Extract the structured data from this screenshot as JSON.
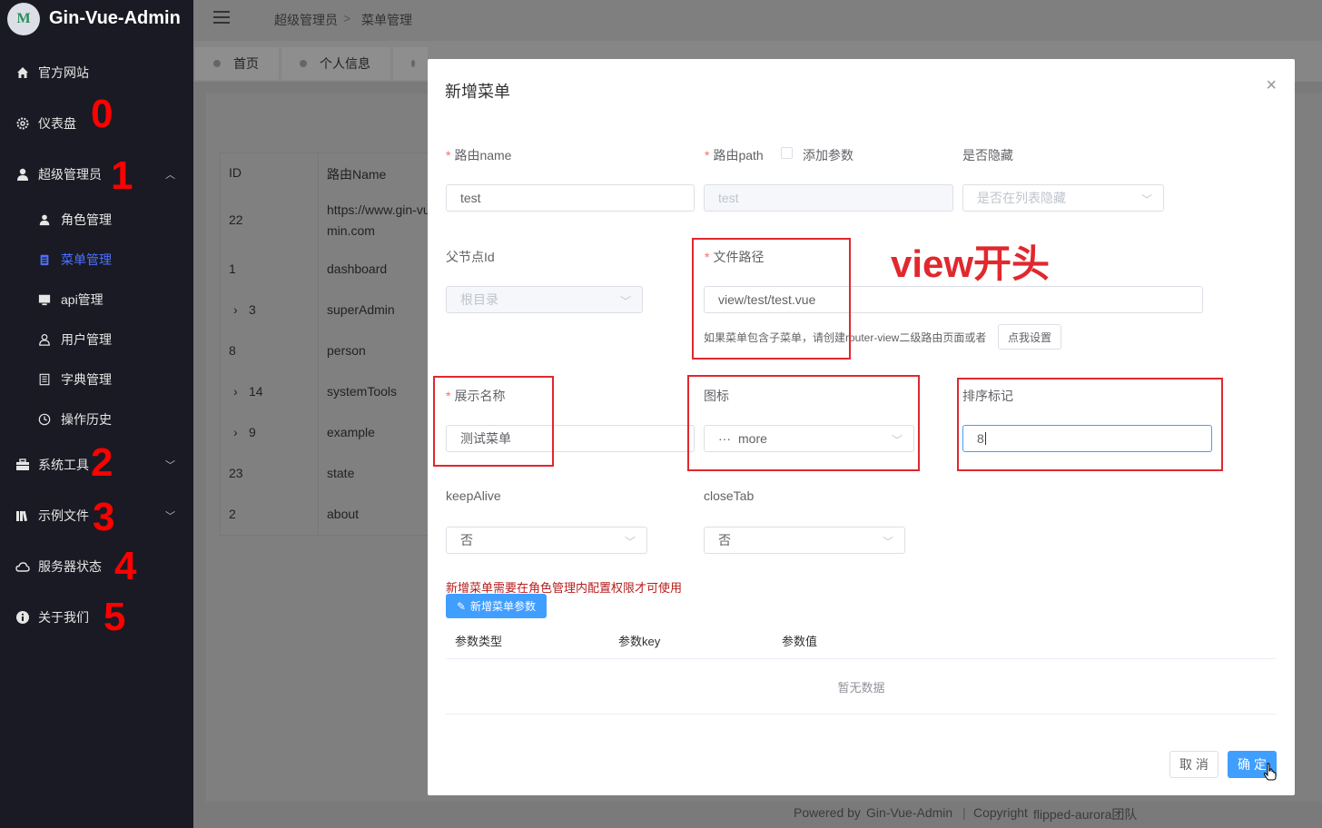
{
  "app": {
    "title": "Gin-Vue-Admin",
    "logo_text": "M"
  },
  "sidebar": {
    "items": [
      {
        "label": "官方网站",
        "icon": "home-icon"
      },
      {
        "label": "仪表盘",
        "icon": "gear-icon",
        "num": "0"
      },
      {
        "label": "超级管理员",
        "icon": "user-icon",
        "num": "1"
      },
      {
        "label": "角色管理",
        "icon": "user-icon"
      },
      {
        "label": "菜单管理",
        "icon": "menu-doc-icon"
      },
      {
        "label": "api管理",
        "icon": "monitor-icon"
      },
      {
        "label": "用户管理",
        "icon": "user-outline-icon"
      },
      {
        "label": "字典管理",
        "icon": "notebook-icon"
      },
      {
        "label": "操作历史",
        "icon": "clock-icon"
      },
      {
        "label": "系统工具",
        "icon": "toolbox-icon",
        "num": "2"
      },
      {
        "label": "示例文件",
        "icon": "files-icon",
        "num": "3"
      },
      {
        "label": "服务器状态",
        "icon": "cloud-icon",
        "num": "4"
      },
      {
        "label": "关于我们",
        "icon": "info-icon",
        "num": "5"
      }
    ]
  },
  "breadcrumb": {
    "root": "超级管理员",
    "sep": ">",
    "current": "菜单管理"
  },
  "tabs": [
    "首页",
    "个人信息"
  ],
  "table": {
    "headers": [
      "ID",
      "路由Name"
    ],
    "rows": [
      {
        "id": "22",
        "name": "https://www.gin-vu",
        "name2": "min.com"
      },
      {
        "id": "1",
        "name": "dashboard"
      },
      {
        "id": "3",
        "name": "superAdmin"
      },
      {
        "id": "8",
        "name": "person"
      },
      {
        "id": "14",
        "name": "systemTools"
      },
      {
        "id": "9",
        "name": "example"
      },
      {
        "id": "23",
        "name": "state"
      },
      {
        "id": "2",
        "name": "about"
      }
    ]
  },
  "footer": {
    "powered": "Powered by",
    "brand": "Gin-Vue-Admin",
    "copyright": "Copyright",
    "team": "flipped-aurora团队"
  },
  "dialog": {
    "title": "新增菜单",
    "close": "×",
    "fields": {
      "route_name": {
        "label": "路由name",
        "value": "test"
      },
      "route_path": {
        "label": "路由path",
        "value": "test",
        "add_param": "添加参数"
      },
      "hidden": {
        "label": "是否隐藏",
        "placeholder": "是否在列表隐藏"
      },
      "parent_id": {
        "label": "父节点Id",
        "value": "根目录"
      },
      "file_path": {
        "label": "文件路径",
        "value": "view/test/test.vue",
        "hint": "如果菜单包含子菜单，请创建router-view二级路由页面或者",
        "hint_button": "点我设置"
      },
      "title": {
        "label": "展示名称",
        "value": "测试菜单"
      },
      "icon": {
        "label": "图标",
        "value": "more"
      },
      "sort": {
        "label": "排序标记",
        "value": "8"
      },
      "keep_alive": {
        "label": "keepAlive",
        "value": "否"
      },
      "close_tab": {
        "label": "closeTab",
        "value": "否"
      }
    },
    "annotation": "view开头",
    "warning": "新增菜单需要在角色管理内配置权限才可使用",
    "add_param_button": "新增菜单参数",
    "param_table": {
      "headers": [
        "参数类型",
        "参数key",
        "参数值"
      ],
      "empty": "暂无数据"
    },
    "cancel": "取 消",
    "confirm": "确 定"
  }
}
